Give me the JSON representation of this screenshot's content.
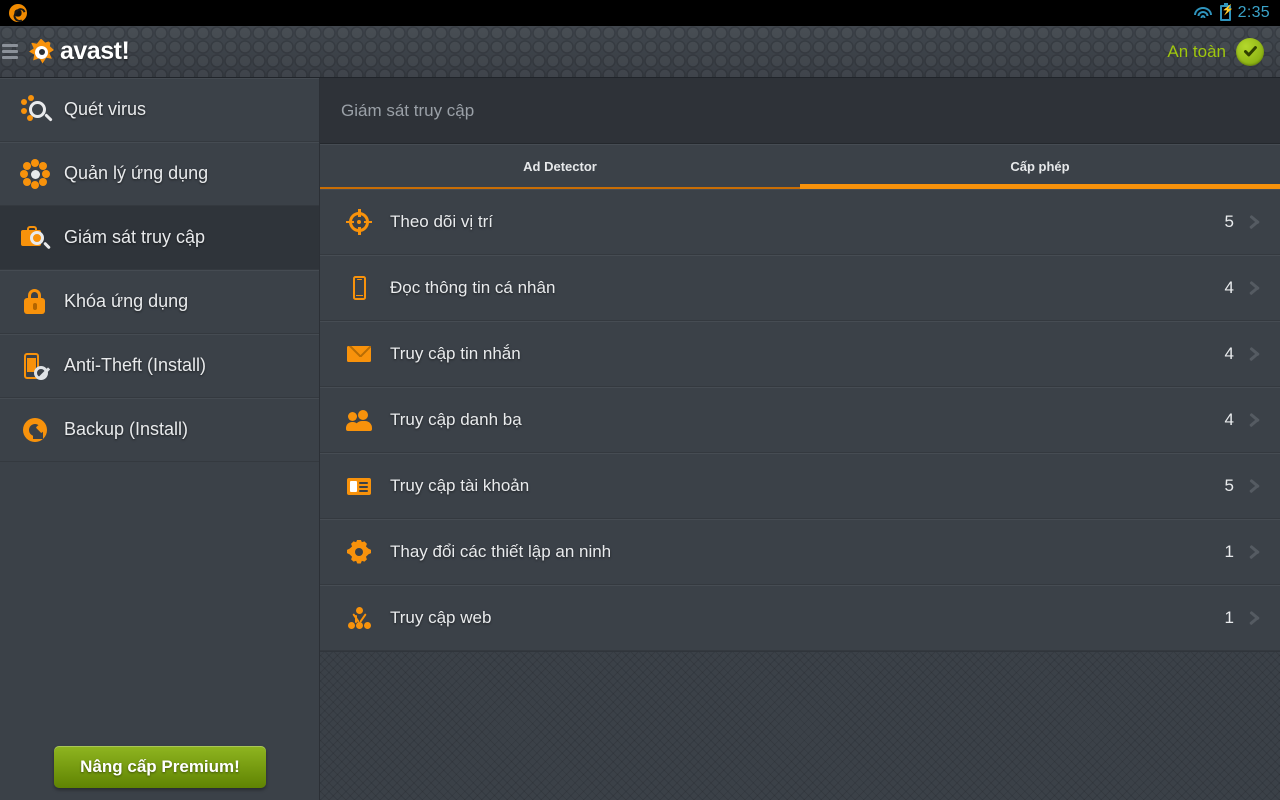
{
  "statusbar": {
    "clock": "2:35",
    "wifi_icon": "wifi-icon",
    "battery_icon": "battery-charging-icon",
    "app_icon": "avast-notification-icon"
  },
  "actionbar": {
    "menu_icon": "hamburger-menu-icon",
    "brand": "avast!",
    "brand_logo_icon": "avast-logo-icon",
    "status_label": "An toàn",
    "status_badge_icon": "check-circle-icon",
    "status_color": "#9fc70d"
  },
  "sidebar": {
    "items": [
      {
        "label": "Quét virus",
        "icon": "virus-scan-icon",
        "active": false
      },
      {
        "label": "Quản lý ứng dụng",
        "icon": "app-manager-icon",
        "active": false
      },
      {
        "label": "Giám sát truy cập",
        "icon": "access-monitor-icon",
        "active": true
      },
      {
        "label": "Khóa ứng dụng",
        "icon": "app-lock-icon",
        "active": false
      },
      {
        "label": "Anti-Theft (Install)",
        "icon": "anti-theft-icon",
        "active": false
      },
      {
        "label": "Backup (Install)",
        "icon": "backup-icon",
        "active": false
      }
    ],
    "premium_button": "Nâng cấp Premium!",
    "premium_color": "#7fa50f"
  },
  "content": {
    "title": "Giám sát truy cập",
    "tabs": [
      {
        "label": "Ad Detector",
        "active": false
      },
      {
        "label": "Cấp phép",
        "active": true
      }
    ],
    "accent_color": "#f8920b",
    "permissions": [
      {
        "label": "Theo dõi vị trí",
        "count": "5",
        "icon": "location-target-icon"
      },
      {
        "label": "Đọc thông tin cá nhân",
        "count": "4",
        "icon": "phone-icon"
      },
      {
        "label": "Truy cập tin nhắn",
        "count": "4",
        "icon": "envelope-icon"
      },
      {
        "label": "Truy cập danh bạ",
        "count": "4",
        "icon": "contacts-people-icon"
      },
      {
        "label": "Truy cập tài khoản",
        "count": "5",
        "icon": "id-card-icon"
      },
      {
        "label": "Thay đổi các thiết lập an ninh",
        "count": "1",
        "icon": "gear-icon"
      },
      {
        "label": "Truy cập web",
        "count": "1",
        "icon": "network-nodes-icon"
      }
    ]
  }
}
